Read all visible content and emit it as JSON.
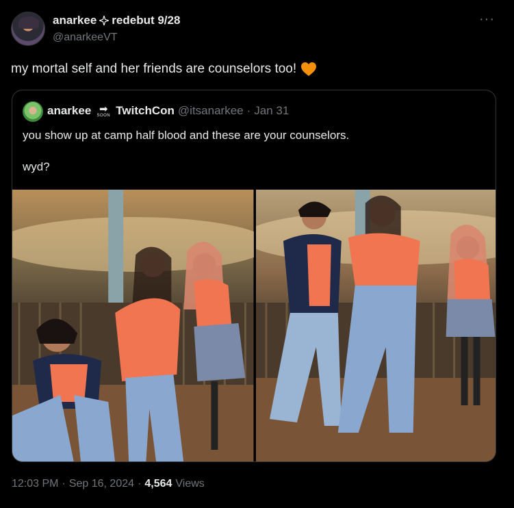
{
  "author": {
    "display_name": "anarkee",
    "name_suffix": "redebut 9/28",
    "handle": "@anarkeeVT",
    "avatar_icon": "avatar-icon"
  },
  "more_label": "···",
  "tweet_text": "my mortal self and her friends are counselors too!",
  "tweet_emoji": "orange-heart-icon",
  "quoted": {
    "display_name": "anarkee",
    "soon_label": "SOON",
    "name_suffix": "TwitchCon",
    "handle": "@itsanarkee",
    "separator": "·",
    "date": "Jan 31",
    "text_line1": "you show up at camp half blood and these are your counselors.",
    "text_line2": "wyd?"
  },
  "meta": {
    "time": "12:03 PM",
    "sep1": "·",
    "date": "Sep 16, 2024",
    "sep2": "·",
    "views_count": "4,564",
    "views_label": "Views"
  },
  "colors": {
    "background": "#000000",
    "text": "#e7e9ea",
    "muted": "#71767b",
    "border": "#333639",
    "heart": "#f4900c",
    "shirt": "#f07550"
  }
}
